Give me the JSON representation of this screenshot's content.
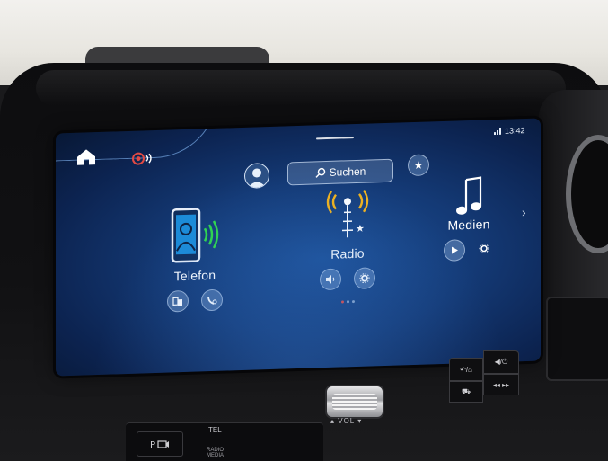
{
  "status": {
    "time": "13:42"
  },
  "search": {
    "label": "Suchen"
  },
  "widgets": {
    "telefon": {
      "label": "Telefon"
    },
    "radio": {
      "label": "Radio"
    },
    "medien": {
      "label": "Medien"
    }
  },
  "hardware": {
    "tel_label": "TEL",
    "radio_media_label_1": "RADIO",
    "radio_media_label_2": "MEDIA",
    "vol_label": "VOL"
  },
  "colors": {
    "screen_bg": "#143a76",
    "phone_accent": "#2fd84a",
    "radio_accent": "#f4b31a",
    "page_dot_active": "#e24a44"
  },
  "icons": {
    "home": "home-icon",
    "voice": "voice-assistant-icon",
    "profile": "user-profile-icon",
    "search": "search-icon",
    "favorite": "star-icon",
    "phone": "phone-icon",
    "radio": "radio-tower-icon",
    "media": "music-note-icon"
  },
  "pagination": {
    "total": 3,
    "active": 1
  }
}
